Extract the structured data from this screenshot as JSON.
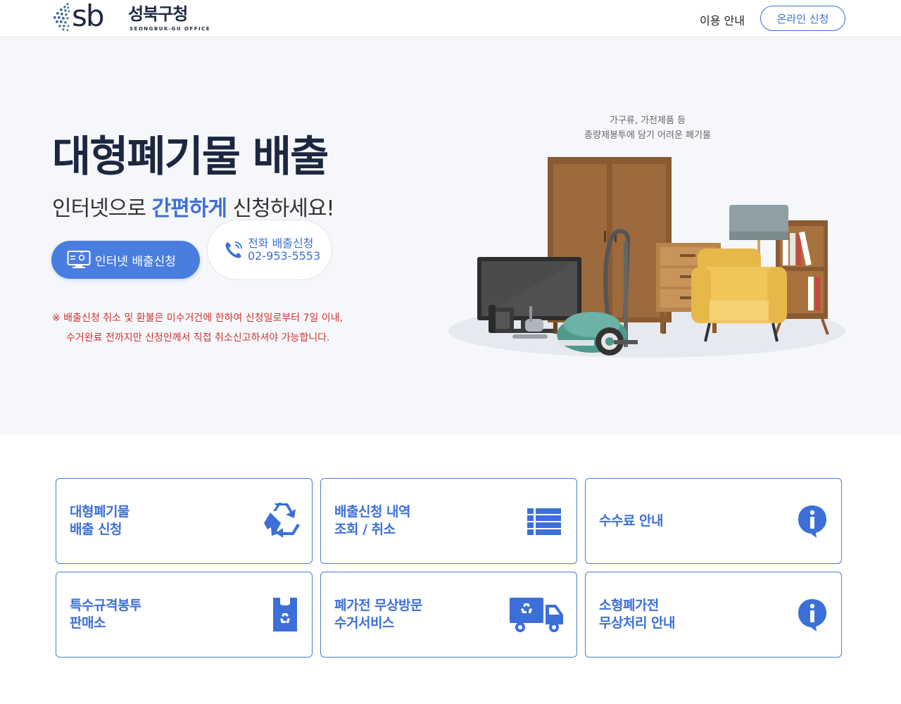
{
  "header": {
    "logo_kor": "성북구청",
    "logo_eng": "SEONGBUK-GU OFFICE",
    "logo_sb": "sb",
    "nav_guide": "이용 안내",
    "nav_online": "온라인 신청"
  },
  "hero": {
    "title": "대형폐기물 배출",
    "sub_before": "인터넷으로 ",
    "sub_highlight": "간편하게",
    "sub_after": " 신청하세요!",
    "btn_internet": "인터넷 배출신청",
    "btn_phone_label": "전화 배출신청",
    "btn_phone_number": "02-953-5553",
    "notice_line1": "※ 배출신청 취소 및 환불은 미수거건에 한하여 신청일로부터 7일 이내,",
    "notice_line2": "수거완료 전까지만 신청인께서 직접 취소신고하셔야 가능합니다.",
    "caption_line1": "가구류, 가전제품 등",
    "caption_line2": "종량제봉투에 담기 어려운 폐기물"
  },
  "tiles": [
    {
      "line1": "대형폐기물",
      "line2": "배출 신청",
      "icon": "recycle-icon"
    },
    {
      "line1": "배출신청 내역",
      "line2": "조회 / 취소",
      "icon": "list-icon"
    },
    {
      "line1": "수수료 안내",
      "line2": "",
      "icon": "info-icon"
    },
    {
      "line1": "특수규격봉투",
      "line2": "판매소",
      "icon": "recycle-bag-icon"
    },
    {
      "line1": "폐가전 무상방문",
      "line2": "수거서비스",
      "icon": "recycle-truck-icon"
    },
    {
      "line1": "소형폐가전",
      "line2": "무상처리 안내",
      "icon": "info-icon"
    }
  ],
  "colors": {
    "accent": "#3c6fd8",
    "button_blue": "#4a7de0",
    "notice_red": "#d0332e",
    "hero_bg": "#f5f7fb",
    "title_navy": "#1c2740"
  }
}
